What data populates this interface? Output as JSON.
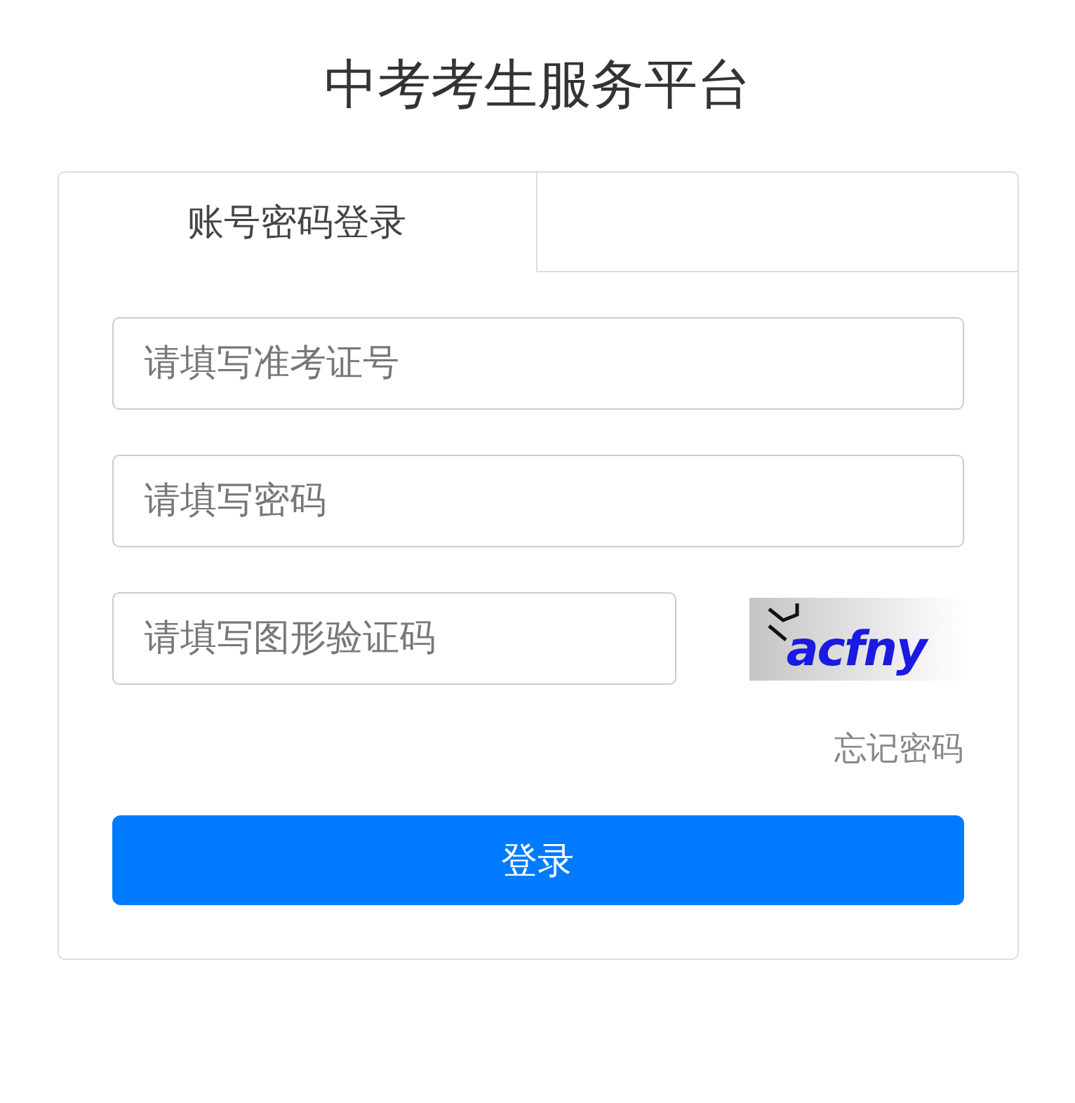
{
  "title": "中考考生服务平台",
  "tabs": [
    {
      "label": "账号密码登录",
      "selected": true
    }
  ],
  "fields": [
    {
      "placeholder": "请填写准考证号",
      "kind": "text"
    },
    {
      "placeholder": "请填写密码",
      "kind": "password"
    },
    {
      "placeholder": "请填写图形验证码",
      "kind": "captcha"
    }
  ],
  "captcha_text": "acfny",
  "forgot_link": "忘记密码",
  "login_button": "登录"
}
